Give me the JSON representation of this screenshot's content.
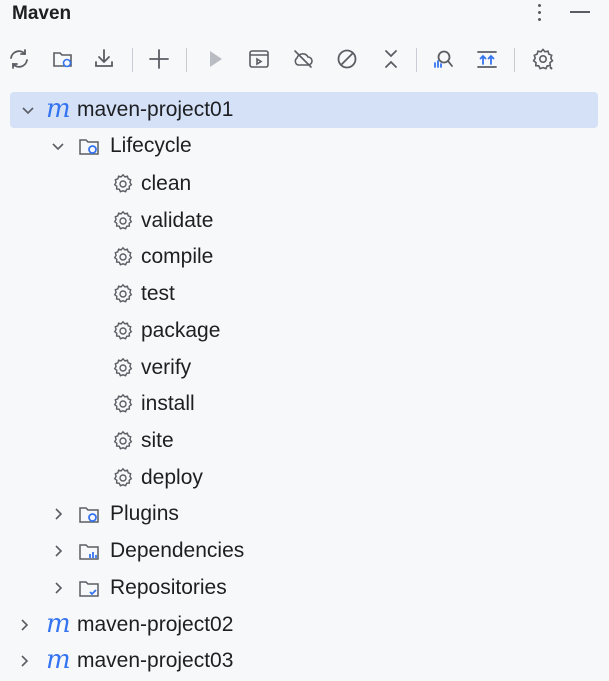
{
  "panel": {
    "title": "Maven"
  },
  "toolbar": {
    "buttons": [
      "reload-all-icon",
      "generate-sources-icon",
      "download-sources-icon",
      "add-project-icon",
      "run-icon",
      "execute-goal-icon",
      "offline-mode-icon",
      "skip-tests-icon",
      "collapse-all-icon",
      "analyze-dependencies-icon",
      "show-dependencies-icon",
      "settings-icon"
    ]
  },
  "tree": {
    "project1": {
      "label": "maven-project01"
    },
    "lifecycle": {
      "label": "Lifecycle",
      "goals": [
        "clean",
        "validate",
        "compile",
        "test",
        "package",
        "verify",
        "install",
        "site",
        "deploy"
      ]
    },
    "plugins": {
      "label": "Plugins"
    },
    "dependencies": {
      "label": "Dependencies"
    },
    "repositories": {
      "label": "Repositories"
    },
    "project2": {
      "label": "maven-project02"
    },
    "project3": {
      "label": "maven-project03"
    }
  },
  "colors": {
    "accent": "#3574f0",
    "selection": "#d5e1f7",
    "background": "#f7f8fa",
    "icon": "#5a5d63"
  }
}
